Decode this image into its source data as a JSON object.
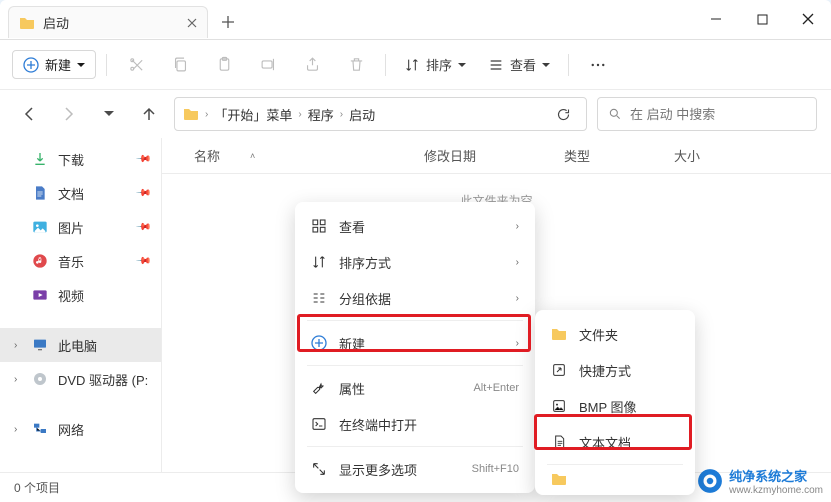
{
  "tab": {
    "title": "启动"
  },
  "toolbar": {
    "new_label": "新建",
    "sort_label": "排序",
    "view_label": "查看"
  },
  "breadcrumb": {
    "items": [
      "「开始」菜单",
      "程序",
      "启动"
    ]
  },
  "search": {
    "placeholder": "在 启动 中搜索"
  },
  "sidebar": {
    "downloads": "下载",
    "documents": "文档",
    "pictures": "图片",
    "music": "音乐",
    "videos": "视频",
    "this_pc": "此电脑",
    "dvd": "DVD 驱动器 (P:",
    "network": "网络"
  },
  "columns": {
    "name": "名称",
    "date": "修改日期",
    "type": "类型",
    "size": "大小"
  },
  "empty_text": "此文件夹为空",
  "status": {
    "count": "0 个项目"
  },
  "context_menu": {
    "view": "查看",
    "sort": "排序方式",
    "group": "分组依据",
    "new": "新建",
    "properties": "属性",
    "properties_shortcut": "Alt+Enter",
    "terminal": "在终端中打开",
    "more": "显示更多选项",
    "more_shortcut": "Shift+F10"
  },
  "submenu": {
    "folder": "文件夹",
    "shortcut": "快捷方式",
    "bmp": "BMP 图像",
    "text": "文本文档"
  },
  "watermark": {
    "name": "纯净系统之家",
    "url": "www.kzmyhome.com"
  }
}
